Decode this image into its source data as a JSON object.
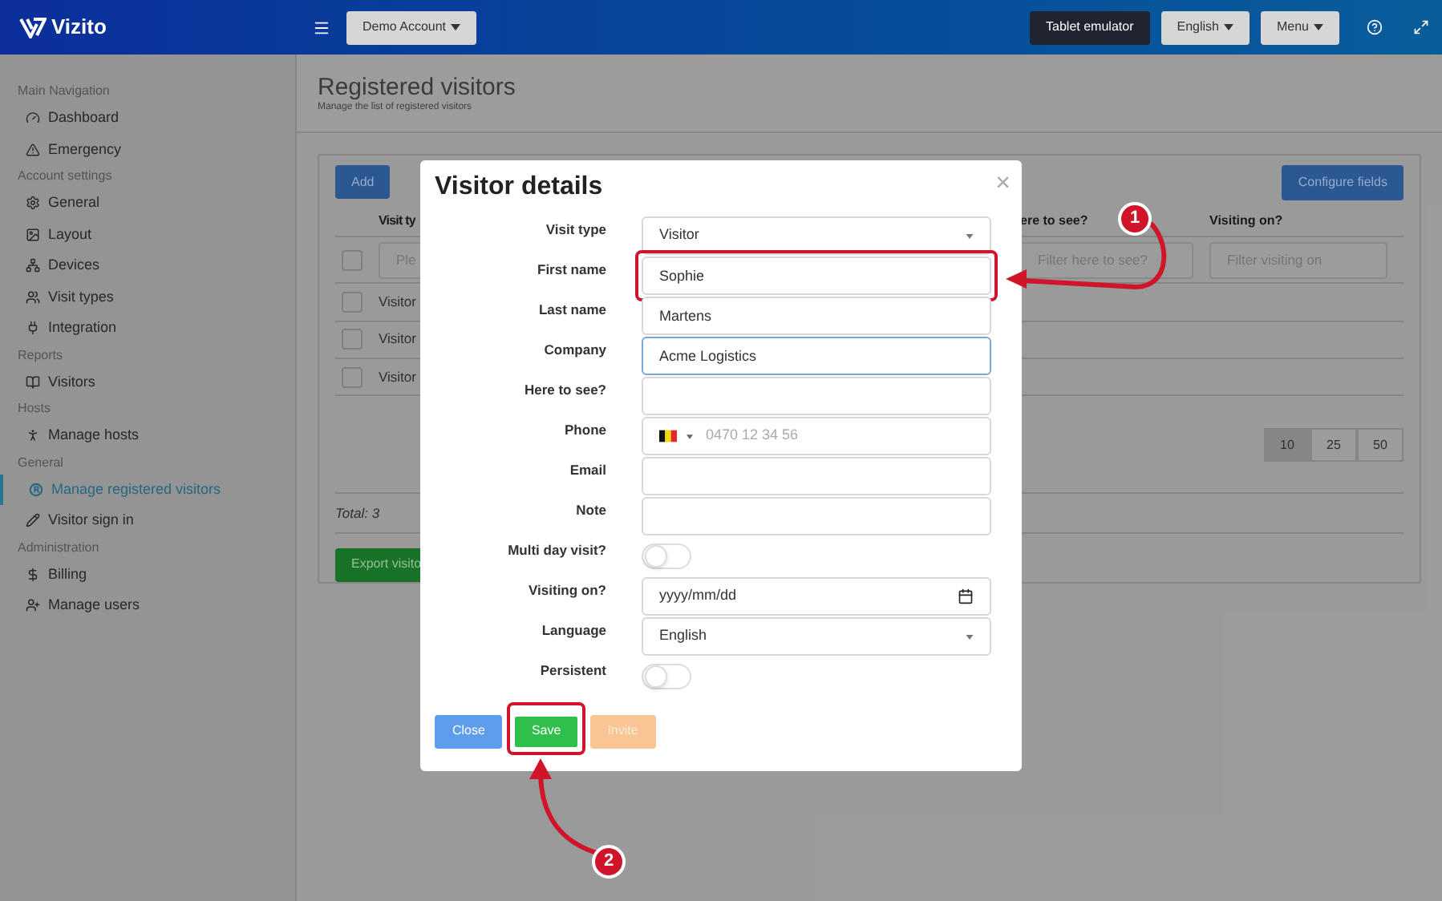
{
  "header": {
    "brand": "Vizito",
    "account_button": "Demo Account",
    "buttons": [
      {
        "label": "Tablet emulator",
        "kind": "dark"
      },
      {
        "label": "English",
        "kind": "dropdown"
      },
      {
        "label": "Menu",
        "kind": "dropdown"
      }
    ]
  },
  "sidebar": {
    "sections": [
      {
        "title": "Main Navigation",
        "items": [
          {
            "label": "Dashboard",
            "selected": false
          },
          {
            "label": "Emergency",
            "selected": false
          }
        ]
      },
      {
        "title": "Account settings",
        "items": [
          {
            "label": "General",
            "selected": false
          },
          {
            "label": "Layout",
            "selected": false
          },
          {
            "label": "Devices",
            "selected": false
          },
          {
            "label": "Visit types",
            "selected": false
          },
          {
            "label": "Integration",
            "selected": false
          }
        ]
      },
      {
        "title": "Reports",
        "items": [
          {
            "label": "Visitors",
            "selected": false
          }
        ]
      },
      {
        "title": "Hosts",
        "items": [
          {
            "label": "Manage hosts",
            "selected": false
          }
        ]
      },
      {
        "title": "General",
        "items": [
          {
            "label": "Manage registered visitors",
            "selected": true
          },
          {
            "label": "Visitor sign in",
            "selected": false
          }
        ]
      },
      {
        "title": "Administration",
        "items": [
          {
            "label": "Billing",
            "selected": false
          },
          {
            "label": "Manage users",
            "selected": false
          }
        ]
      }
    ]
  },
  "page": {
    "title": "Registered visitors",
    "subtitle": "Manage the list of registered visitors"
  },
  "card": {
    "add_button": "Add",
    "configure_button": "Configure fields",
    "table": {
      "columns": [
        "Visit ty",
        "ere to see?",
        "Visiting on?"
      ],
      "select_all": {
        "checked": false
      },
      "filters": [
        {
          "placeholder": "Ple"
        },
        {
          "placeholder": "Filter here to see?"
        },
        {
          "placeholder": "Filter visiting on"
        }
      ],
      "rows": [
        {
          "visit_type": "Visitor",
          "checked": false
        },
        {
          "visit_type": "Visitor",
          "checked": false
        },
        {
          "visit_type": "Visitor",
          "checked": false
        }
      ]
    },
    "page_sizes": [
      {
        "label": "10",
        "selected": true
      },
      {
        "label": "25",
        "selected": false
      },
      {
        "label": "50",
        "selected": false
      }
    ],
    "total": "Total: 3",
    "export_button": "Export visito"
  },
  "modal": {
    "title": "Visitor details",
    "close_icon": "×",
    "fields": [
      {
        "label": "Visit type",
        "kind": "select",
        "value": "Visitor"
      },
      {
        "label": "First name",
        "kind": "text",
        "value": "Sophie",
        "focused": false,
        "highlighted": true
      },
      {
        "label": "Last name",
        "kind": "text",
        "value": "Martens",
        "focused": false,
        "highlighted": false
      },
      {
        "label": "Company",
        "kind": "text",
        "value": "Acme Logistics",
        "focused": true,
        "highlighted": false
      },
      {
        "label": "Here to see?",
        "kind": "text",
        "focused": false,
        "highlighted": false
      },
      {
        "label": "Phone",
        "kind": "phone",
        "placeholder": "0470 12 34 56"
      },
      {
        "label": "Email",
        "kind": "text",
        "focused": false,
        "highlighted": false
      },
      {
        "label": "Note",
        "kind": "text",
        "focused": false,
        "highlighted": false
      },
      {
        "label": "Multi day visit?",
        "kind": "toggle",
        "on": false
      },
      {
        "label": "Visiting on?",
        "kind": "date",
        "placeholder": "yyyy/mm/dd"
      },
      {
        "label": "Language",
        "kind": "select",
        "value": "English"
      },
      {
        "label": "Persistent",
        "kind": "toggle",
        "on": false
      }
    ],
    "buttons": [
      {
        "label": "Close",
        "kind": "close",
        "disabled": false,
        "highlighted": false
      },
      {
        "label": "Save",
        "kind": "save",
        "disabled": false,
        "highlighted": true
      },
      {
        "label": "Invite",
        "kind": "invite",
        "disabled": true,
        "highlighted": false
      }
    ]
  },
  "annotations": [
    {
      "number": "1"
    },
    {
      "number": "2"
    }
  ]
}
